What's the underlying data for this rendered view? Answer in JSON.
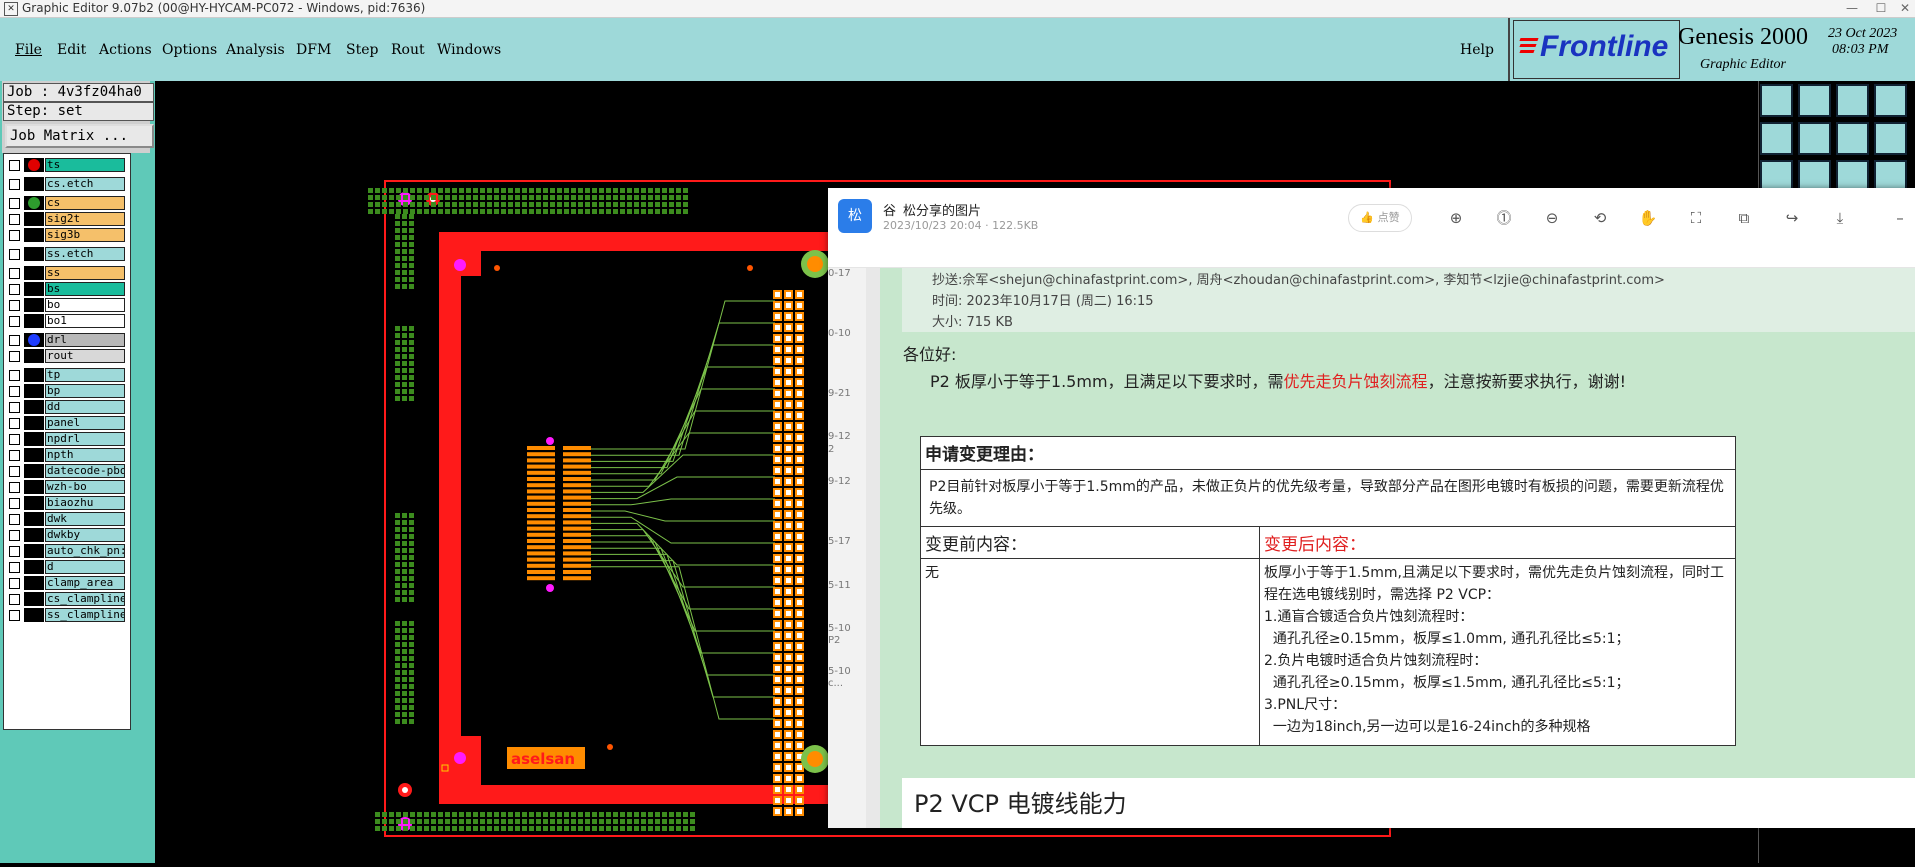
{
  "window": {
    "title": "Graphic Editor 9.07b2 (00@HY-HYCAM-PC072 - Windows, pid:7636)",
    "min": "—",
    "max": "☐",
    "close": "✕"
  },
  "menu": {
    "items": [
      "File",
      "Edit",
      "Actions",
      "Options",
      "Analysis",
      "DFM",
      "Step",
      "Rout",
      "Windows"
    ],
    "help": "Help"
  },
  "brand": {
    "logo": "Frontline",
    "product": "Genesis 2000",
    "subtitle": "Graphic Editor",
    "date": "23 Oct 2023",
    "time": "08:03 PM"
  },
  "job": {
    "job_label": "Job : 4v3fz04ha0",
    "step_label": "Step: set",
    "matrix_button": "Job Matrix ..."
  },
  "layers": [
    {
      "name": "ts",
      "color": "#1abc9c",
      "dot": "#e00000"
    },
    {
      "name": "cs.etch",
      "color": "#9ed9d9",
      "gap": true
    },
    {
      "name": "cs",
      "color": "#f5c06a",
      "dot": "#2e9c2e",
      "gap": true
    },
    {
      "name": "sig2t",
      "color": "#f5c06a"
    },
    {
      "name": "sig3b",
      "color": "#f5c06a"
    },
    {
      "name": "ss.etch",
      "color": "#9ed9d9",
      "gap": true
    },
    {
      "name": "ss",
      "color": "#f5c06a",
      "gap": true
    },
    {
      "name": "bs",
      "color": "#1abc9c"
    },
    {
      "name": "bo",
      "color": "#ffffff"
    },
    {
      "name": "bo1",
      "color": "#ffffff"
    },
    {
      "name": "drl",
      "color": "#b8b8b8",
      "dot": "#1e3cff",
      "gap": true
    },
    {
      "name": "rout",
      "color": "#d8d8d8"
    },
    {
      "name": "tp",
      "color": "#9ed9d9",
      "gap": true
    },
    {
      "name": "bp",
      "color": "#9ed9d9"
    },
    {
      "name": "dd",
      "color": "#9ed9d9"
    },
    {
      "name": "panel",
      "color": "#9ed9d9"
    },
    {
      "name": "npdrl",
      "color": "#9ed9d9"
    },
    {
      "name": "npth",
      "color": "#9ed9d9"
    },
    {
      "name": "datecode-pbo",
      "color": "#9ed9d9"
    },
    {
      "name": "wzh-bo",
      "color": "#9ed9d9"
    },
    {
      "name": "biaozhu",
      "color": "#9ed9d9"
    },
    {
      "name": "dwk",
      "color": "#9ed9d9"
    },
    {
      "name": "dwkby",
      "color": "#9ed9d9"
    },
    {
      "name": "auto_chk_pn:",
      "color": "#9ed9d9"
    },
    {
      "name": "d",
      "color": "#9ed9d9"
    },
    {
      "name": "clamp_area",
      "color": "#9ed9d9"
    },
    {
      "name": "cs_clampline",
      "color": "#9ed9d9"
    },
    {
      "name": "ss_clampline",
      "color": "#9ed9d9"
    }
  ],
  "board": {
    "silk_text": "aselsan"
  },
  "viewer": {
    "avatar": "松",
    "sender": "谷",
    "title": "松分享的图片",
    "meta": "2023/10/23 20:04 · 122.5KB",
    "like": "点赞",
    "side_dates": [
      "0-17",
      "0-10",
      "9-21",
      "9-12",
      "2",
      "9-12",
      "5-17",
      "5-11",
      "5-10",
      "P2",
      "5-10",
      "c..."
    ],
    "email": {
      "cc": "抄送:佘军<shejun@chinafastprint.com>, 周舟<zhoudan@chinafastprint.com>, 李知节<lzjie@chinafastprint.com>",
      "time": "时间: 2023年10月17日 (周二) 16:15",
      "size": "大小: 715 KB",
      "greeting": "各位好:",
      "body_prefix": "P2 板厚小于等于1.5mm，且满足以下要求时，需",
      "body_red": "优先走负片蚀刻流程",
      "body_suffix": "，注意按新要求执行，谢谢!",
      "reason_title": "申请变更理由：",
      "reason_text": "P2目前针对板厚小于等于1.5mm的产品，未做正负片的优先级考量，导致部分产品在图形电镀时有板损的问题，需要更新流程优先级。",
      "before_header": "变更前内容：",
      "after_header": "变更后内容：",
      "before_content": "无",
      "after_lines": [
        "板厚小于等于1.5mm,且满足以下要求时，需优先走负片蚀刻流程，同时工程在选电镀线别时，需选择 P2 VCP：",
        "1.通盲合镀适合负片蚀刻流程时：",
        "  通孔孔径≥0.15mm，板厚≤1.0mm, 通孔孔径比≤5:1；",
        "2.负片电镀时适合负片蚀刻流程时：",
        "  通孔孔径≥0.15mm，板厚≤1.5mm, 通孔孔径比≤5:1；",
        "3.PNL尺寸：",
        "  一边为18inch,另一边可以是16-24inch的多种规格"
      ],
      "footer_heading": "P2 VCP 电镀线能力"
    }
  },
  "colors": {
    "teal": "#9ed9d9",
    "board_red": "#ff1a1a",
    "pad_green": "#3c8c1e",
    "magenta": "#ff1aff",
    "trace": "#7cc24a",
    "red_text": "#e02020"
  }
}
